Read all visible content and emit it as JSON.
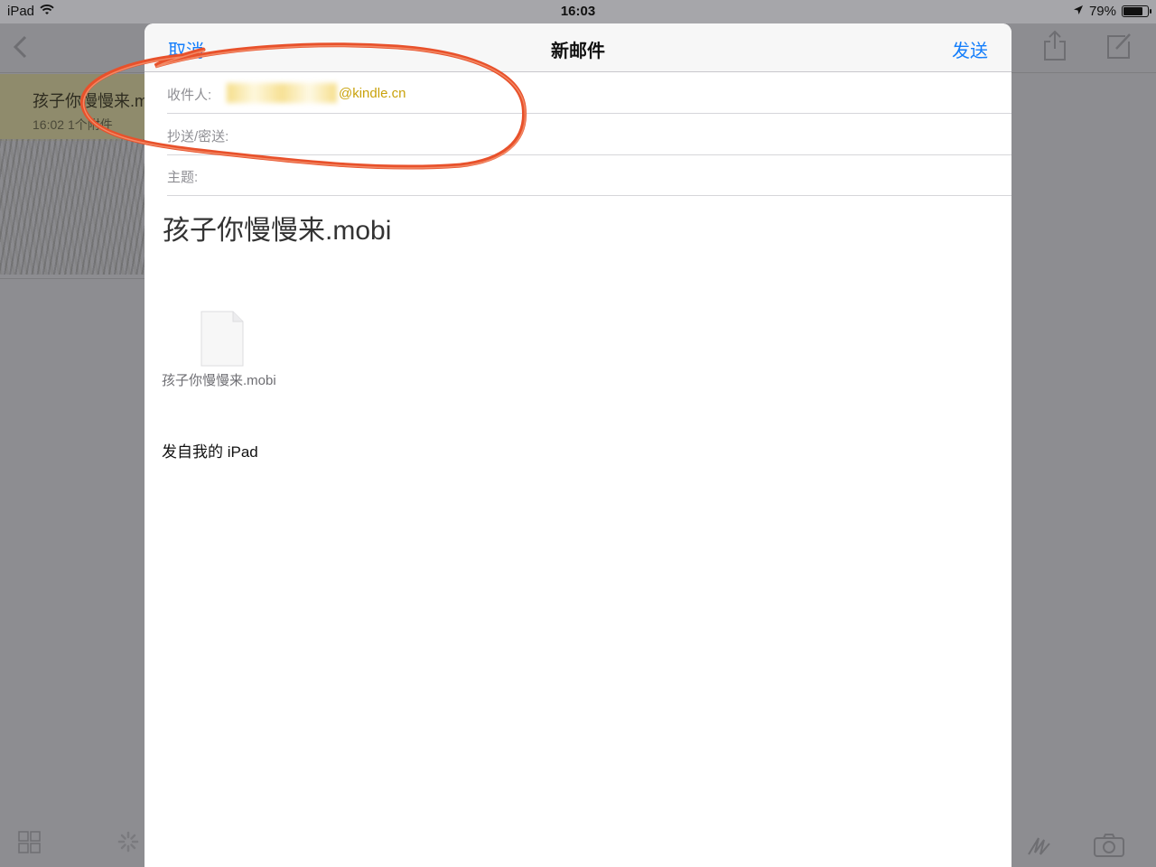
{
  "status_bar": {
    "device": "iPad",
    "time": "16:03",
    "battery_percent": "79%",
    "battery_level": 0.79,
    "icons": [
      "wifi-icon",
      "location-arrow-icon",
      "battery-icon"
    ]
  },
  "background_app": {
    "message_title": "孩子你慢慢来.m",
    "message_time": "16:02",
    "message_meta": "1个附件",
    "highlight_color": "#8f8b6c",
    "icons": [
      "back-chevron-icon",
      "share-icon",
      "compose-icon",
      "grid-icon",
      "spinner-icon",
      "markup-icon",
      "camera-icon"
    ]
  },
  "compose": {
    "cancel_label": "取消",
    "title": "新邮件",
    "send_label": "发送",
    "to_label": "收件人:",
    "to_value": "@kindle.cn",
    "cc_label": "抄送/密送:",
    "subject_label": "主题:",
    "body_title": "孩子你慢慢来.mobi",
    "attachment_name": "孩子你慢慢来.mobi",
    "signature": "发自我的 iPad",
    "accent_color": "#147efb",
    "recipient_color": "#c9a20b"
  },
  "annotation": {
    "shape": "hand-drawn loop around recipient fields",
    "color": "#e8512b"
  }
}
